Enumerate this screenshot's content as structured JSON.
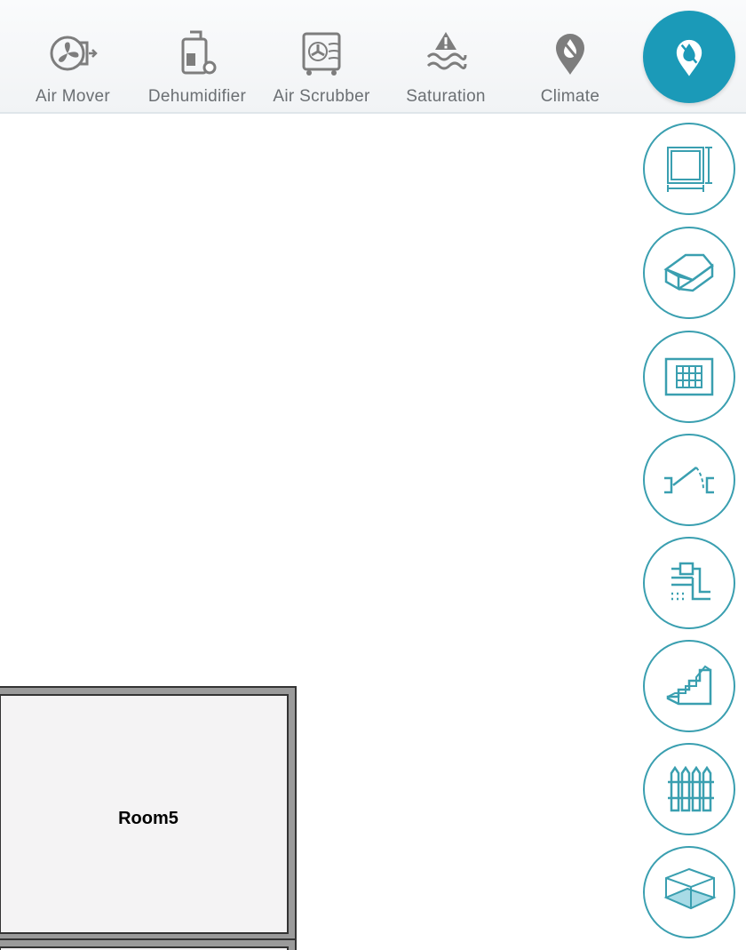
{
  "toolbar": {
    "tools": [
      {
        "label": "Air Mover",
        "icon": "air-mover-icon"
      },
      {
        "label": "Dehumidifier",
        "icon": "dehumidifier-icon"
      },
      {
        "label": "Air Scrubber",
        "icon": "air-scrubber-icon"
      },
      {
        "label": "Saturation",
        "icon": "saturation-icon"
      },
      {
        "label": "Climate",
        "icon": "climate-icon"
      }
    ],
    "active_tool_icon": "moisture-drop-pin-icon"
  },
  "side_buttons": [
    {
      "icon": "room-dimensions-icon"
    },
    {
      "icon": "house-icon"
    },
    {
      "icon": "window-icon"
    },
    {
      "icon": "door-icon"
    },
    {
      "icon": "plumbing-icon"
    },
    {
      "icon": "stairs-icon"
    },
    {
      "icon": "fence-icon"
    },
    {
      "icon": "floor-box-icon"
    }
  ],
  "canvas": {
    "rooms": [
      {
        "label": "Room5"
      }
    ]
  },
  "colors": {
    "accent": "#1b9ab8",
    "icon_stroke": "#3a9fb0",
    "toolbar_icon": "#7d7d7d"
  }
}
